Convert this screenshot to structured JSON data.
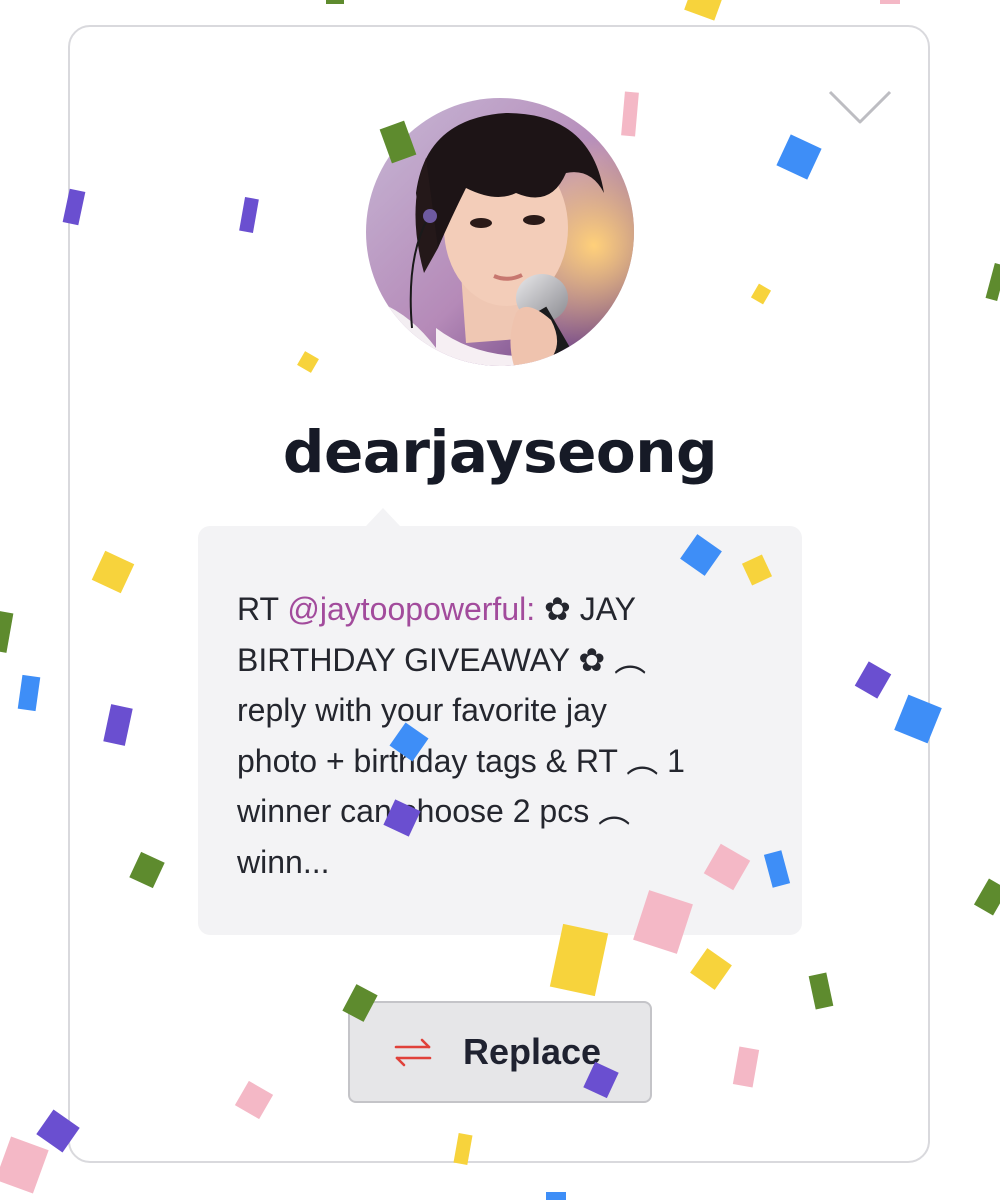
{
  "profile": {
    "username": "dearjayseong",
    "avatar_icon": "profile-photo"
  },
  "tweet": {
    "prefix": "RT ",
    "mention": "@jaytoopowerful:",
    "body": " ✿ JAY\nBIRTHDAY GIVEAWAY ✿ ︵\nreply with your favorite jay\nphoto + birthday tags & RT ︵ 1\nwinner can choose 2 pcs ︵\nwinn..."
  },
  "actions": {
    "replace_label": "Replace",
    "replace_icon": "swap-arrows-icon",
    "collapse_icon": "chevron-down-icon"
  },
  "colors": {
    "mention": "#a24b9c",
    "replace_icon": "#e0413a",
    "confetti": [
      "#f7d33c",
      "#3e8ef7",
      "#6a4fd0",
      "#5e8b2e",
      "#f4b8c6"
    ]
  }
}
